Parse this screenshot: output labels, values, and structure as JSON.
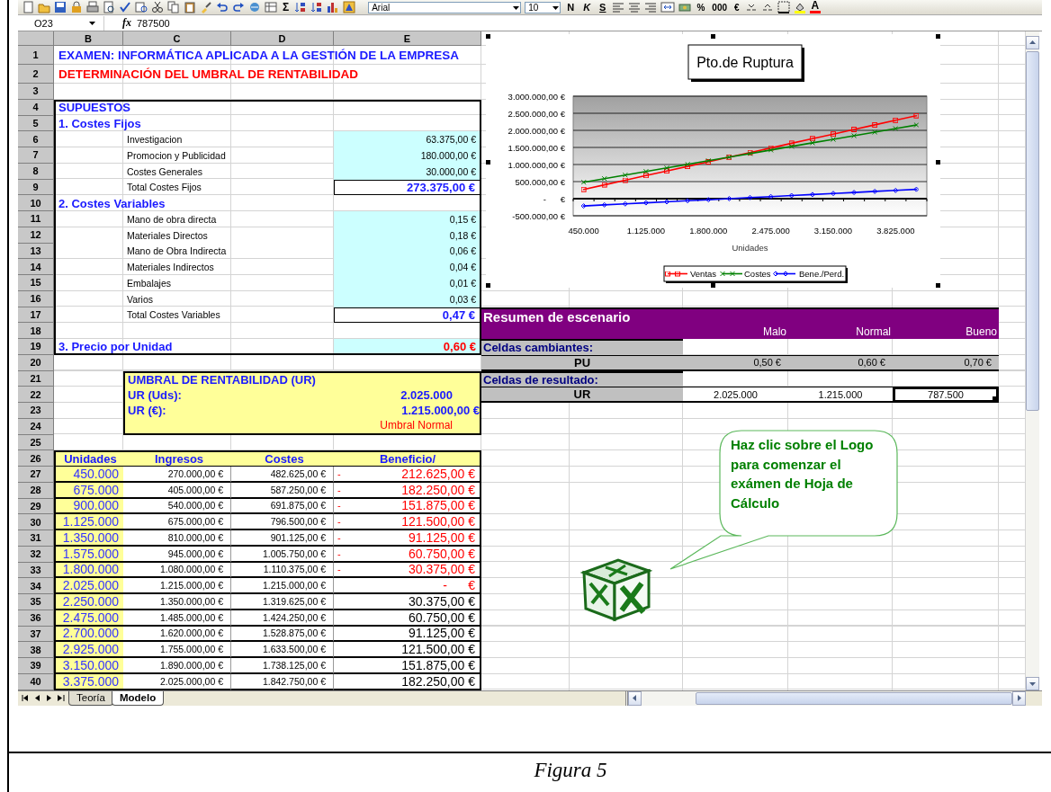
{
  "toolbar": {
    "sum_button": "Σ",
    "font_name": "Arial",
    "font_size": "10",
    "style_buttons": [
      "N",
      "K",
      "S"
    ],
    "number_buttons": [
      "%",
      "000",
      "€"
    ],
    "font_color_button": "A"
  },
  "formula_bar": {
    "cell_ref": "O23",
    "function_label": "fx",
    "value": "787500"
  },
  "columns": [
    "B",
    "C",
    "D",
    "E"
  ],
  "row_numbers": [
    "1",
    "2",
    "3",
    "4",
    "5",
    "6",
    "7",
    "8",
    "9",
    "10",
    "11",
    "12",
    "13",
    "14",
    "15",
    "16",
    "17",
    "18",
    "19",
    "20",
    "21",
    "22",
    "23",
    "24",
    "25",
    "26",
    "27",
    "28",
    "29",
    "30",
    "31",
    "32",
    "33",
    "34",
    "35",
    "36",
    "37",
    "38",
    "39",
    "40"
  ],
  "assumptions": [
    {
      "kind": "title",
      "text": "EXAMEN: INFORMÁTICA APLICADA A LA GESTIÓN DE LA EMPRESA"
    },
    {
      "kind": "subtitle",
      "text": "DETERMINACIÓN DEL UMBRAL DE RENTABILIDAD"
    },
    {
      "kind": "blank"
    },
    {
      "kind": "section",
      "text": "SUPUESTOS"
    },
    {
      "kind": "section",
      "text": "1. Costes Fijos"
    },
    {
      "kind": "item",
      "label": "Investigacion",
      "value": "63.375,00 €"
    },
    {
      "kind": "item",
      "label": "Promocion y Publicidad",
      "value": "180.000,00 €"
    },
    {
      "kind": "item",
      "label": "Costes Generales",
      "value": "30.000,00 €"
    },
    {
      "kind": "total",
      "label": "Total Costes Fijos",
      "value": "273.375,00 €"
    },
    {
      "kind": "section",
      "text": "2. Costes Variables"
    },
    {
      "kind": "item",
      "label": "Mano de obra directa",
      "value": "0,15 €"
    },
    {
      "kind": "item",
      "label": "Materiales Directos",
      "value": "0,18 €"
    },
    {
      "kind": "item",
      "label": "Mano de Obra Indirecta",
      "value": "0,06 €"
    },
    {
      "kind": "item",
      "label": "Materiales Indirectos",
      "value": "0,04 €"
    },
    {
      "kind": "item",
      "label": "Embalajes",
      "value": "0,01 €"
    },
    {
      "kind": "item",
      "label": "Varios",
      "value": "0,03 €"
    },
    {
      "kind": "total",
      "label": "Total Costes Variables",
      "value": "0,47 €"
    },
    {
      "kind": "blank"
    },
    {
      "kind": "price",
      "label": "3. Precio por Unidad",
      "value": "0,60 €"
    }
  ],
  "threshold_box": {
    "title": "UMBRAL DE RENTABILIDAD (UR)",
    "lines": [
      {
        "label": "UR (Uds):",
        "value": "2.025.000"
      },
      {
        "label": "UR (€):",
        "value": "1.215.000,00 €"
      }
    ],
    "note": "Umbral Normal"
  },
  "table": {
    "columns": [
      "Unidades",
      "Ingresos",
      "Costes",
      "Beneficio/"
    ],
    "rows": [
      {
        "units": "450.000",
        "income": "270.000,00 €",
        "costs": "482.625,00 €",
        "sign": "-",
        "profit": "212.625,00 €",
        "loss": true
      },
      {
        "units": "675.000",
        "income": "405.000,00 €",
        "costs": "587.250,00 €",
        "sign": "-",
        "profit": "182.250,00 €",
        "loss": true
      },
      {
        "units": "900.000",
        "income": "540.000,00 €",
        "costs": "691.875,00 €",
        "sign": "-",
        "profit": "151.875,00 €",
        "loss": true
      },
      {
        "units": "1.125.000",
        "income": "675.000,00 €",
        "costs": "796.500,00 €",
        "sign": "-",
        "profit": "121.500,00 €",
        "loss": true
      },
      {
        "units": "1.350.000",
        "income": "810.000,00 €",
        "costs": "901.125,00 €",
        "sign": "-",
        "profit": "91.125,00 €",
        "loss": true
      },
      {
        "units": "1.575.000",
        "income": "945.000,00 €",
        "costs": "1.005.750,00 €",
        "sign": "-",
        "profit": "60.750,00 €",
        "loss": true
      },
      {
        "units": "1.800.000",
        "income": "1.080.000,00 €",
        "costs": "1.110.375,00 €",
        "sign": "-",
        "profit": "30.375,00 €",
        "loss": true
      },
      {
        "units": "2.025.000",
        "income": "1.215.000,00 €",
        "costs": "1.215.000,00 €",
        "profit": "-      €",
        "loss": true
      },
      {
        "units": "2.250.000",
        "income": "1.350.000,00 €",
        "costs": "1.319.625,00 €",
        "profit": "30.375,00 €",
        "loss": false
      },
      {
        "units": "2.475.000",
        "income": "1.485.000,00 €",
        "costs": "1.424.250,00 €",
        "profit": "60.750,00 €",
        "loss": false
      },
      {
        "units": "2.700.000",
        "income": "1.620.000,00 €",
        "costs": "1.528.875,00 €",
        "profit": "91.125,00 €",
        "loss": false
      },
      {
        "units": "2.925.000",
        "income": "1.755.000,00 €",
        "costs": "1.633.500,00 €",
        "profit": "121.500,00 €",
        "loss": false
      },
      {
        "units": "3.150.000",
        "income": "1.890.000,00 €",
        "costs": "1.738.125,00 €",
        "profit": "151.875,00 €",
        "loss": false
      },
      {
        "units": "3.375.000",
        "income": "2.025.000,00 €",
        "costs": "1.842.750,00 €",
        "profit": "182.250,00 €",
        "loss": false
      }
    ]
  },
  "chart": {
    "chart_data": {
      "type": "line",
      "title": "Pto.de Ruptura",
      "xlabel": "Unidades",
      "xlim": [
        337500,
        4162500
      ],
      "grid": true,
      "legend": true,
      "x": [
        450000,
        675000,
        900000,
        1125000,
        1350000,
        1575000,
        1800000,
        2025000,
        2250000,
        2475000,
        2700000,
        2925000,
        3150000,
        3375000,
        3600000,
        3825000,
        4050000
      ],
      "xticks": [
        {
          "value": 450000,
          "label": "450.000"
        },
        {
          "value": 1125000,
          "label": "1.125.000"
        },
        {
          "value": 1800000,
          "label": "1.800.000"
        },
        {
          "value": 2475000,
          "label": "2.475.000"
        },
        {
          "value": 3150000,
          "label": "3.150.000"
        },
        {
          "value": 3825000,
          "label": "3.825.000"
        }
      ],
      "ylim": [
        -500000,
        3000000
      ],
      "yticks": [
        {
          "value": -500000,
          "label": "-500.000,00 €"
        },
        {
          "value": 0,
          "label": "-      €"
        },
        {
          "value": 500000,
          "label": "500.000,00 €"
        },
        {
          "value": 1000000,
          "label": "1.000.000,00 €"
        },
        {
          "value": 1500000,
          "label": "1.500.000,00 €"
        },
        {
          "value": 2000000,
          "label": "2.000.000,00 €"
        },
        {
          "value": 2500000,
          "label": "2.500.000,00 €"
        },
        {
          "value": 3000000,
          "label": "3.000.000,00 €"
        }
      ],
      "series": [
        {
          "name": "Ventas",
          "color": "#ff0000",
          "values": [
            270000,
            405000,
            540000,
            675000,
            810000,
            945000,
            1080000,
            1215000,
            1350000,
            1485000,
            1620000,
            1755000,
            1890000,
            2025000,
            2160000,
            2295000,
            2430000
          ]
        },
        {
          "name": "Costes",
          "color": "#008000",
          "values": [
            482625,
            587250,
            691875,
            796500,
            901125,
            1005750,
            1110375,
            1215000,
            1319625,
            1424250,
            1528875,
            1633500,
            1738125,
            1842750,
            1947375,
            2052000,
            2156625
          ]
        },
        {
          "name": "Bene./Perd.",
          "color": "#0000ff",
          "values": [
            -212625,
            -182250,
            -151875,
            -121500,
            -91125,
            -60750,
            -30375,
            0,
            30375,
            60750,
            91125,
            121500,
            151875,
            182250,
            212625,
            243000,
            273375
          ]
        }
      ]
    }
  },
  "scenario": {
    "title": "Resumen de escenario",
    "headers": [
      "Malo",
      "Normal",
      "Bueno"
    ],
    "groups": [
      {
        "kind": "changing",
        "label": "Celdas cambiantes:",
        "row_label": "PU",
        "values": [
          {
            "text": "0,50 €",
            "selected": false
          },
          {
            "text": "0,60 €",
            "selected": false
          },
          {
            "text": "0,70 €",
            "selected": false
          }
        ]
      },
      {
        "kind": "result",
        "label": "Celdas de resultado:",
        "row_label": "UR",
        "values": [
          {
            "text": "2.025.000",
            "selected": false
          },
          {
            "text": "1.215.000",
            "selected": false
          },
          {
            "text": "787.500",
            "selected": true
          }
        ]
      }
    ]
  },
  "callout": {
    "text": "Haz clic sobre el Logo para comenzar el exámen de Hoja de Cálculo"
  },
  "tabs": [
    {
      "label": "Teoría",
      "selected": false
    },
    {
      "label": "Modelo",
      "selected": true
    }
  ],
  "caption": "Figura 5"
}
